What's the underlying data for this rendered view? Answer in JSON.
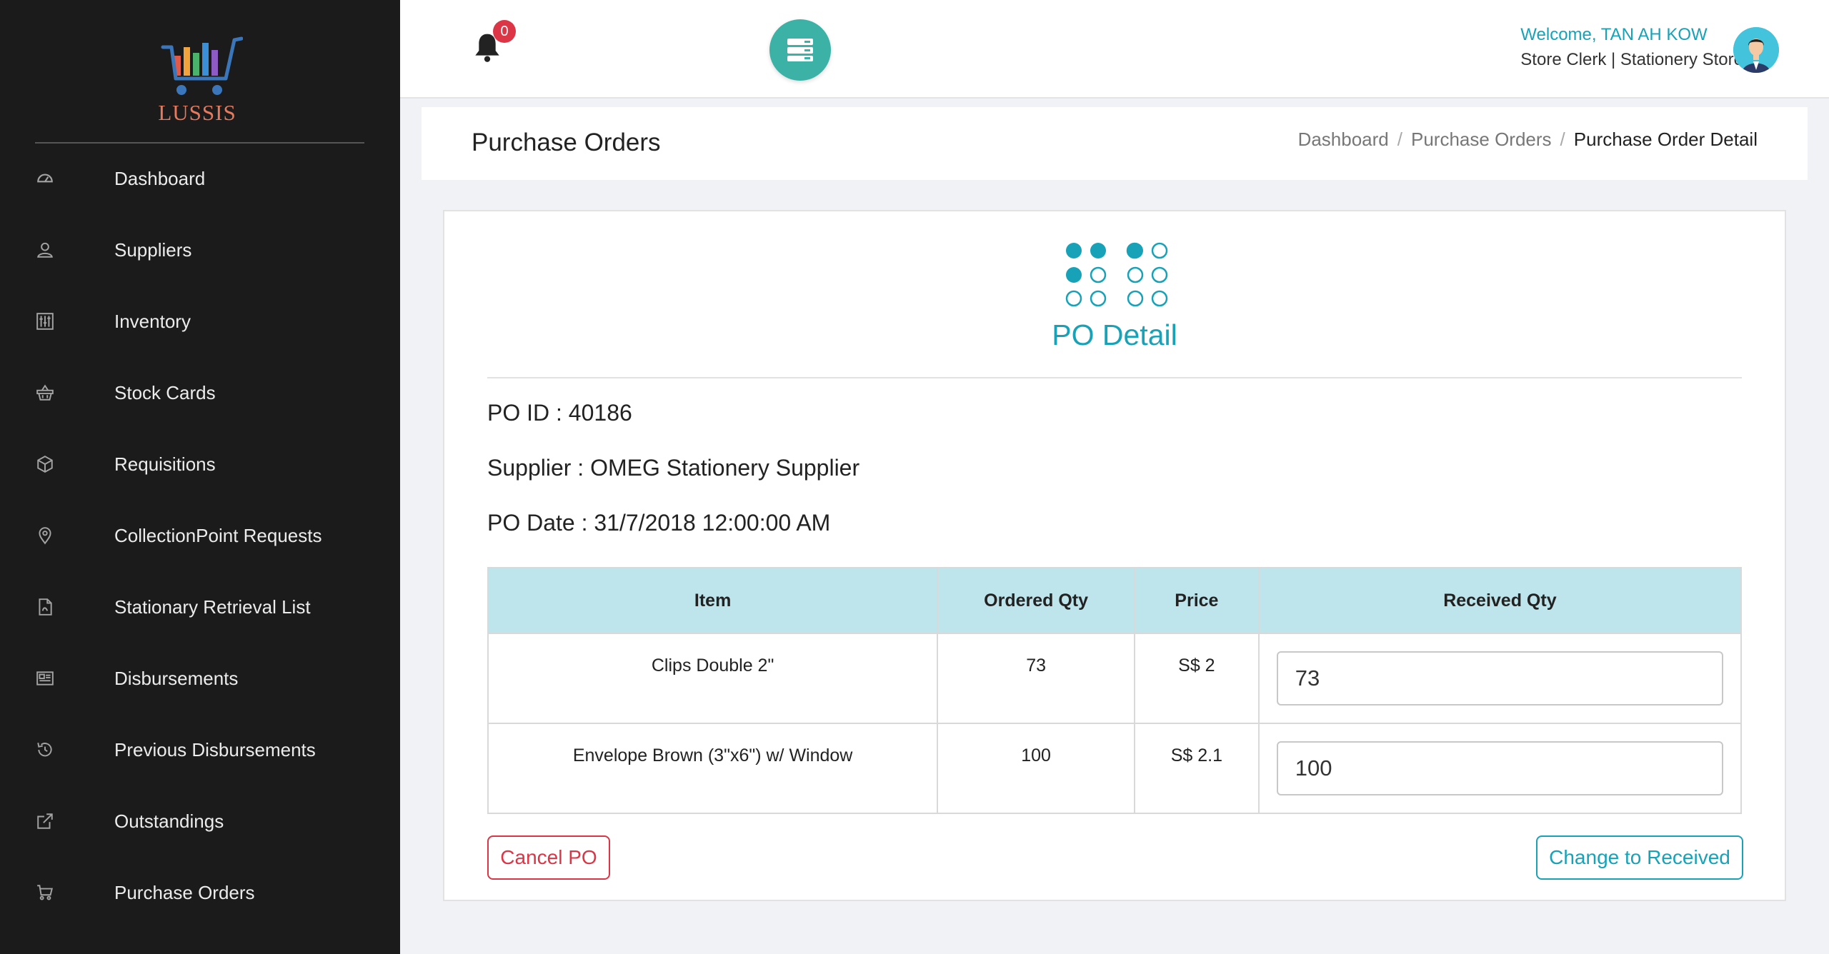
{
  "sidebar": {
    "logo_text": "LUSSIS",
    "items": [
      {
        "label": "Dashboard",
        "icon": "dashboard-icon"
      },
      {
        "label": "Suppliers",
        "icon": "user-icon"
      },
      {
        "label": "Inventory",
        "icon": "sliders-icon"
      },
      {
        "label": "Stock Cards",
        "icon": "basket-icon"
      },
      {
        "label": "Requisitions",
        "icon": "package-icon"
      },
      {
        "label": "CollectionPoint Requests",
        "icon": "location-pin-icon"
      },
      {
        "label": "Stationary Retrieval List",
        "icon": "pdf-file-icon"
      },
      {
        "label": "Disbursements",
        "icon": "newspaper-icon"
      },
      {
        "label": "Previous Disbursements",
        "icon": "history-icon"
      },
      {
        "label": "Outstandings",
        "icon": "external-link-icon"
      },
      {
        "label": "Purchase Orders",
        "icon": "shopping-cart-icon"
      }
    ]
  },
  "header": {
    "notification_count": "0",
    "welcome": "Welcome, TAN AH KOW",
    "role": "Store Clerk | Stationery Store"
  },
  "page": {
    "title": "Purchase Orders",
    "breadcrumb": [
      "Dashboard",
      "Purchase Orders",
      "Purchase Order Detail"
    ]
  },
  "card": {
    "heading": "PO Detail",
    "po_id": "PO ID : 40186",
    "supplier": "Supplier : OMEG Stationery Supplier",
    "po_date": "PO Date : 31/7/2018 12:00:00 AM",
    "table": {
      "headers": [
        "Item",
        "Ordered Qty",
        "Price",
        "Received Qty"
      ],
      "rows": [
        {
          "item": "Clips Double 2\"",
          "ordered_qty": "73",
          "price": "S$ 2",
          "received_qty": "73"
        },
        {
          "item": "Envelope Brown (3\"x6\") w/ Window",
          "ordered_qty": "100",
          "price": "S$ 2.1",
          "received_qty": "100"
        }
      ]
    },
    "cancel_label": "Cancel PO",
    "received_label": "Change to Received"
  },
  "colors": {
    "sidebar_bg": "#1b1b1b",
    "accent_teal": "#17a2b8",
    "toggle_teal": "#3bb2a5",
    "danger": "#dc3545",
    "logo_orange": "#e7795d",
    "table_header_bg": "#bee5eb"
  }
}
